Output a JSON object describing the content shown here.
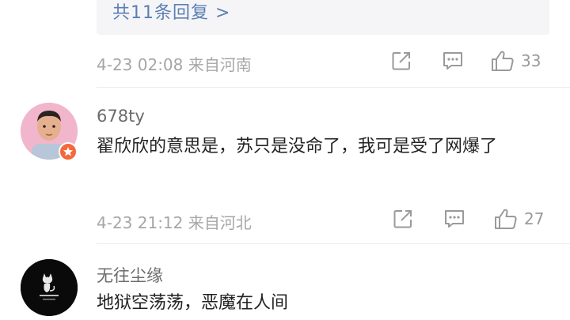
{
  "thread": {
    "reply_link": "共11条回复 >"
  },
  "comments": [
    {
      "meta": "4-23 02:08  来自河南",
      "likes": "33"
    },
    {
      "username": "678ty",
      "text": "翟欣欣的意思是，苏只是没命了，我可是受了网爆了",
      "meta": "4-23 21:12  来自河北",
      "likes": "27"
    },
    {
      "username": "无往尘缘",
      "text": "地狱空荡荡，恶魔在人间"
    }
  ],
  "icons": {
    "share": "share-icon",
    "comment": "comment-icon",
    "like": "thumbs-up-icon",
    "badge": "verified-badge-icon"
  },
  "colors": {
    "link": "#5b7fb5",
    "meta": "#a6a6a6",
    "badge": "#f26a3c",
    "reply_bg": "#f5f5f7"
  }
}
